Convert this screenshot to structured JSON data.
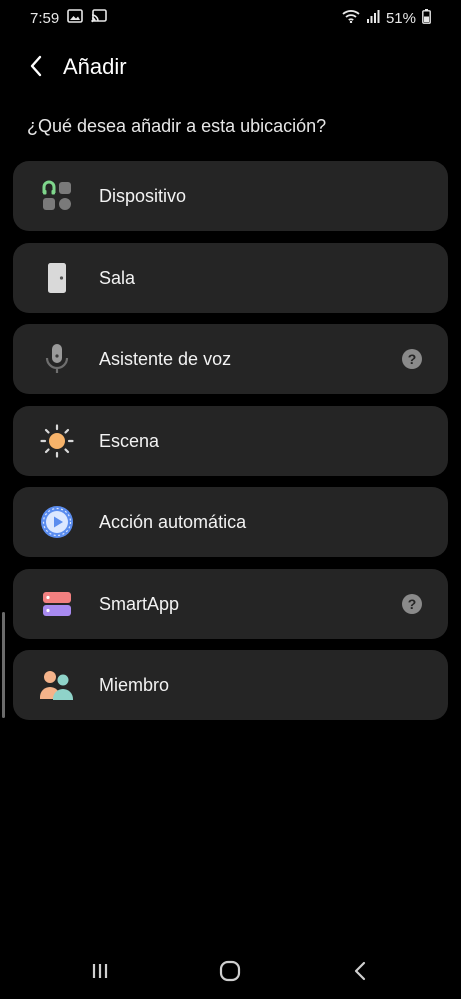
{
  "status_bar": {
    "time": "7:59",
    "battery": "51%",
    "icons": [
      "image-icon",
      "cast-icon",
      "wifi-icon",
      "signal-icon",
      "battery-icon"
    ]
  },
  "header": {
    "title": "Añadir",
    "back_icon": "chevron-left-icon"
  },
  "subtitle": "¿Qué desea añadir a esta ubicación?",
  "options": [
    {
      "label": "Dispositivo",
      "icon": "device-icon",
      "help": false
    },
    {
      "label": "Sala",
      "icon": "door-icon",
      "help": false
    },
    {
      "label": "Asistente de voz",
      "icon": "microphone-icon",
      "help": true
    },
    {
      "label": "Escena",
      "icon": "sun-icon",
      "help": false
    },
    {
      "label": "Acción automática",
      "icon": "automation-play-icon",
      "help": false
    },
    {
      "label": "SmartApp",
      "icon": "smartapp-icon",
      "help": true
    },
    {
      "label": "Miembro",
      "icon": "members-icon",
      "help": false
    }
  ],
  "help_glyph": "?",
  "nav_bar": {
    "icons": [
      "recent-apps-icon",
      "home-icon",
      "back-icon"
    ]
  },
  "colors": {
    "background": "#000000",
    "card": "#252525",
    "device_accent": "#7fd68c",
    "sun": "#f7b36a",
    "automation": "#5b8def",
    "smartapp_top": "#f28080",
    "smartapp_bottom": "#a88af0",
    "member_a": "#f4b38a",
    "member_b": "#8fd3c9"
  }
}
